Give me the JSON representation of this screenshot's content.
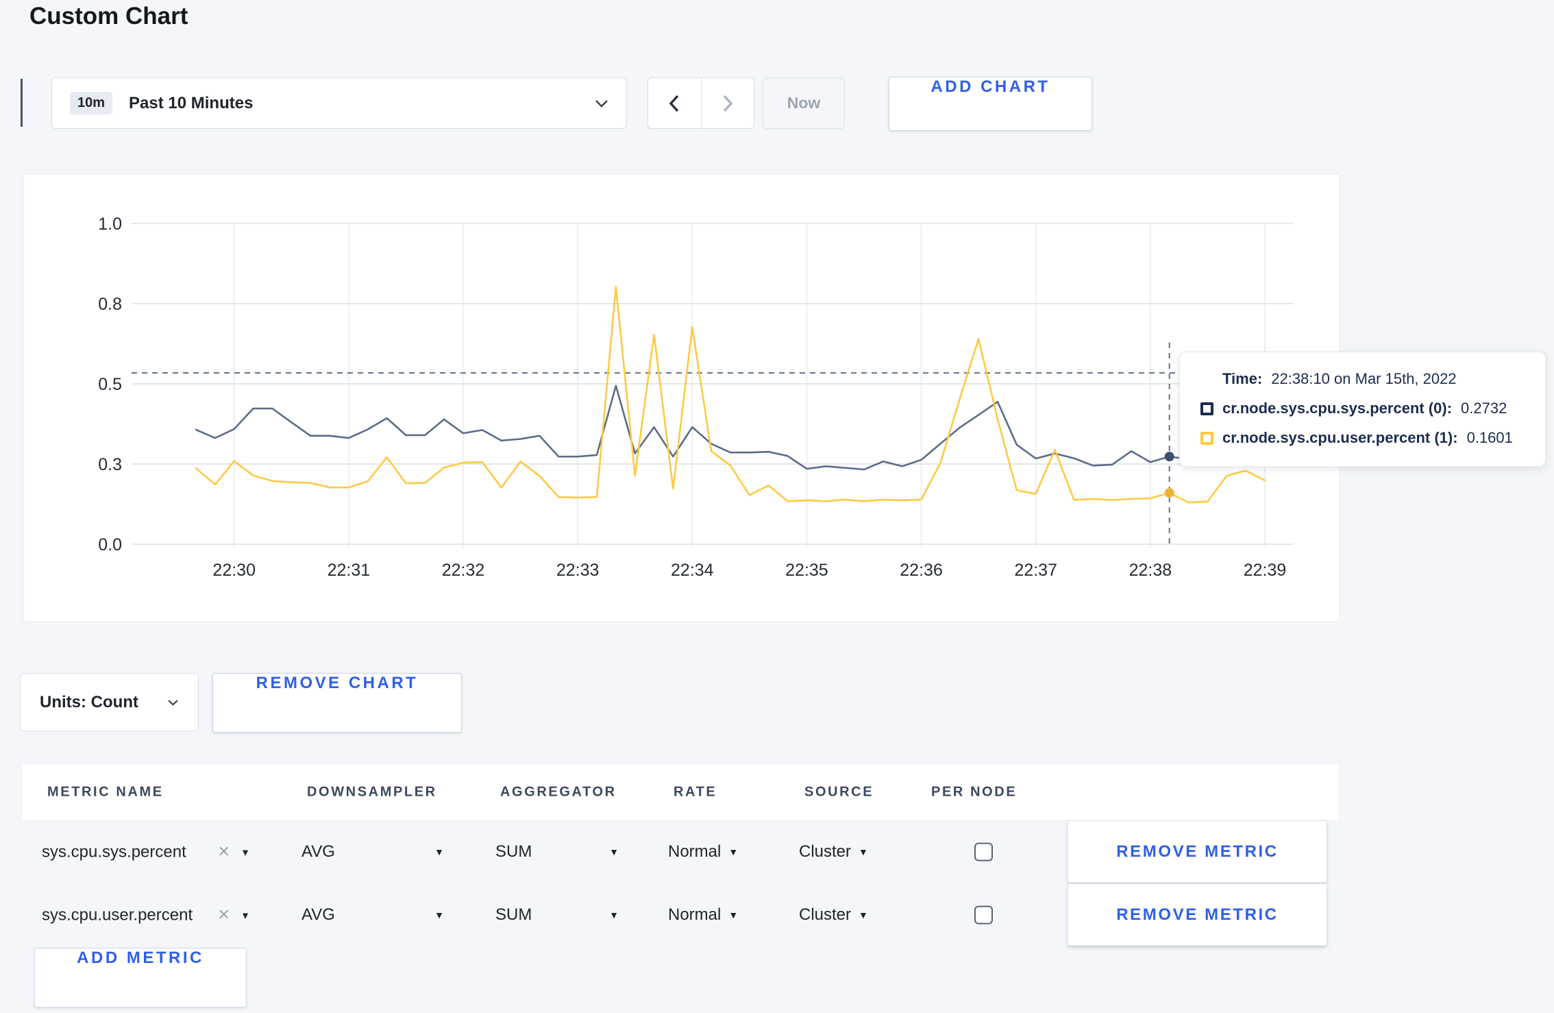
{
  "page": {
    "title": "Custom Chart"
  },
  "toolbar": {
    "time_badge": "10m",
    "time_label": "Past 10 Minutes",
    "now_label": "Now",
    "add_chart_label": "ADD CHART"
  },
  "chart": {
    "tooltip": {
      "time_label": "Time:",
      "time_value": "22:38:10 on Mar 15th, 2022",
      "series": [
        {
          "label": "cr.node.sys.cpu.sys.percent (0):",
          "value": "0.2732",
          "swatch_color": "#1c2c50"
        },
        {
          "label": "cr.node.sys.cpu.user.percent (1):",
          "value": "0.1601",
          "swatch_color": "#fdca44"
        }
      ]
    }
  },
  "units_bar": {
    "units_label": "Units: Count",
    "remove_chart_label": "REMOVE CHART"
  },
  "metrics_table": {
    "headers": [
      "METRIC NAME",
      "DOWNSAMPLER",
      "AGGREGATOR",
      "RATE",
      "SOURCE",
      "PER NODE"
    ],
    "rows": [
      {
        "metric": "sys.cpu.sys.percent",
        "downsampler": "AVG",
        "aggregator": "SUM",
        "rate": "Normal",
        "source": "Cluster",
        "per_node_checked": false,
        "remove_label": "REMOVE METRIC"
      },
      {
        "metric": "sys.cpu.user.percent",
        "downsampler": "AVG",
        "aggregator": "SUM",
        "rate": "Normal",
        "source": "Cluster",
        "per_node_checked": false,
        "remove_label": "REMOVE METRIC"
      }
    ],
    "add_metric_label": "ADD METRIC"
  },
  "chart_data": {
    "type": "line",
    "title": "",
    "xlabel": "",
    "ylabel": "",
    "ylim": [
      0,
      1
    ],
    "grid": true,
    "y_tick_values": [
      0,
      0.25,
      0.5,
      0.75,
      1.0
    ],
    "y_tick_labels": [
      "0.0",
      "0.3",
      "0.5",
      "0.8",
      "1.0"
    ],
    "x_tick_labels": [
      "22:30",
      "22:31",
      "22:32",
      "22:33",
      "22:34",
      "22:35",
      "22:36",
      "22:37",
      "22:38",
      "22:39"
    ],
    "x": [
      "22:29:40",
      "22:29:50",
      "22:30:00",
      "22:30:10",
      "22:30:20",
      "22:30:30",
      "22:30:40",
      "22:30:50",
      "22:31:00",
      "22:31:10",
      "22:31:20",
      "22:31:30",
      "22:31:40",
      "22:31:50",
      "22:32:00",
      "22:32:10",
      "22:32:20",
      "22:32:30",
      "22:32:40",
      "22:32:50",
      "22:33:00",
      "22:33:10",
      "22:33:20",
      "22:33:30",
      "22:33:40",
      "22:33:50",
      "22:34:00",
      "22:34:10",
      "22:34:20",
      "22:34:30",
      "22:34:40",
      "22:34:50",
      "22:35:00",
      "22:35:10",
      "22:35:20",
      "22:35:30",
      "22:35:40",
      "22:35:50",
      "22:36:00",
      "22:36:10",
      "22:36:20",
      "22:36:30",
      "22:36:40",
      "22:36:50",
      "22:37:00",
      "22:37:10",
      "22:37:20",
      "22:37:30",
      "22:37:40",
      "22:37:50",
      "22:38:00",
      "22:38:10",
      "22:38:20",
      "22:38:30",
      "22:38:40",
      "22:38:50",
      "22:39:00"
    ],
    "series": [
      {
        "name": "cr.node.sys.cpu.sys.percent",
        "color": "#5a6c87",
        "dot_color": "#3f4f6d",
        "values": [
          0.357,
          0.331,
          0.359,
          0.423,
          0.423,
          0.38,
          0.338,
          0.338,
          0.331,
          0.358,
          0.393,
          0.34,
          0.34,
          0.389,
          0.346,
          0.356,
          0.323,
          0.328,
          0.338,
          0.273,
          0.273,
          0.278,
          0.494,
          0.283,
          0.365,
          0.273,
          0.365,
          0.313,
          0.286,
          0.286,
          0.288,
          0.275,
          0.235,
          0.243,
          0.238,
          0.233,
          0.258,
          0.243,
          0.263,
          0.313,
          0.363,
          0.403,
          0.444,
          0.31,
          0.267,
          0.283,
          0.268,
          0.245,
          0.248,
          0.29,
          0.256,
          0.2732,
          0.265,
          0.273,
          0.283,
          0.273,
          0.283
        ]
      },
      {
        "name": "cr.node.sys.cpu.user.percent",
        "color": "#fdca44",
        "dot_color": "#edb430",
        "values": [
          0.237,
          0.186,
          0.259,
          0.214,
          0.197,
          0.193,
          0.191,
          0.177,
          0.177,
          0.196,
          0.271,
          0.19,
          0.191,
          0.239,
          0.254,
          0.256,
          0.177,
          0.258,
          0.213,
          0.147,
          0.145,
          0.147,
          0.803,
          0.213,
          0.653,
          0.173,
          0.677,
          0.29,
          0.245,
          0.153,
          0.183,
          0.134,
          0.137,
          0.134,
          0.139,
          0.134,
          0.139,
          0.137,
          0.139,
          0.253,
          0.45,
          0.64,
          0.39,
          0.168,
          0.157,
          0.294,
          0.138,
          0.141,
          0.138,
          0.141,
          0.143,
          0.1601,
          0.13,
          0.133,
          0.213,
          0.229,
          0.199
        ]
      }
    ],
    "crosshair": {
      "index": 51,
      "x_time": "22:38:10",
      "hline_value": 0.534
    },
    "legend_position": "tooltip-only"
  },
  "colors": {
    "accent_blue": "#2f5fea",
    "line_sys": "#5a6c87",
    "line_user": "#fdca44",
    "page_bg": "#f4f6f9"
  }
}
